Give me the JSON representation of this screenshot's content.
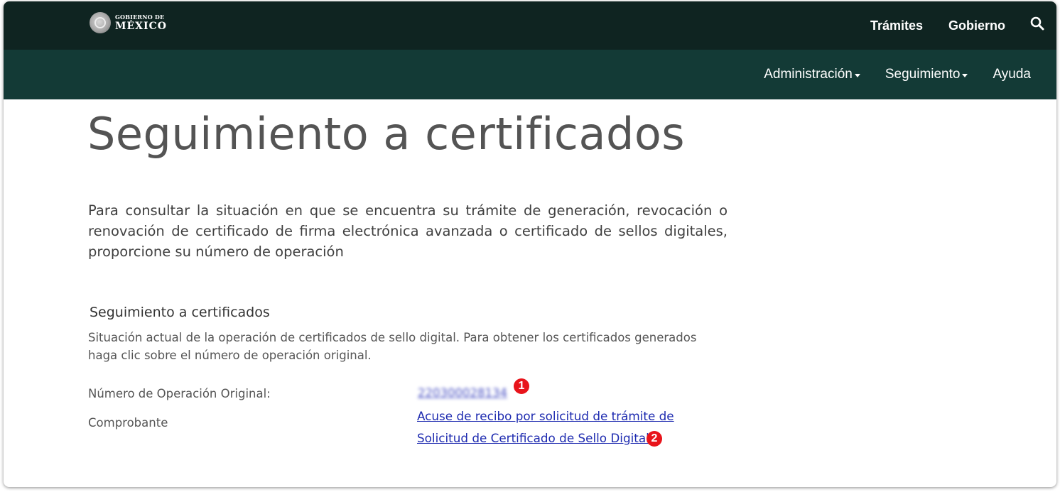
{
  "header": {
    "logo": {
      "line1": "GOBIERNO DE",
      "line2": "MÉXICO"
    },
    "nav": [
      {
        "label": "Trámites"
      },
      {
        "label": "Gobierno"
      }
    ],
    "search_icon": "search-icon"
  },
  "subnav": {
    "items": [
      {
        "label": "Administración",
        "dropdown": true
      },
      {
        "label": "Seguimiento",
        "dropdown": true
      },
      {
        "label": "Ayuda",
        "dropdown": false
      }
    ]
  },
  "page": {
    "title": "Seguimiento a certificados",
    "intro": "Para consultar la situación en que se encuentra su trámite de generación, revocación o renovación de certificado de firma electrónica avanzada o certificado de sellos digitales, proporcione su número de operación"
  },
  "section": {
    "title": "Seguimiento a certificados",
    "description": "Situación actual de la operación de certificados de sello digital. Para obtener los certificados generados haga clic sobre el número de operación original.",
    "operation_label": "Número de Operación Original:",
    "operation_number": "220300028134",
    "receipt_label": "Comprobante",
    "receipt_link": "Acuse de recibo por solicitud de trámite de Solicitud de Certificado de Sello Digital"
  },
  "annotations": {
    "badge1": "1",
    "badge2": "2"
  },
  "colors": {
    "header_bg": "#0f2421",
    "subnav_bg": "#133a36",
    "link": "#1e2bb0",
    "badge": "#e8141b"
  }
}
